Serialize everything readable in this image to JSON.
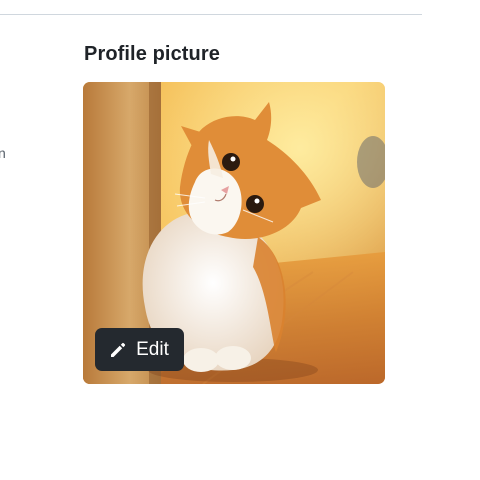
{
  "sidebar": {
    "fragment_text": "n"
  },
  "profile_picture": {
    "title": "Profile picture",
    "image_subject": "ginger-and-white-cat",
    "edit_label": "Edit",
    "edit_icon": "pencil-icon"
  },
  "colors": {
    "title_text": "#1f2328",
    "button_bg": "#24292f",
    "button_text": "#ffffff",
    "divider": "#d0d7de"
  }
}
